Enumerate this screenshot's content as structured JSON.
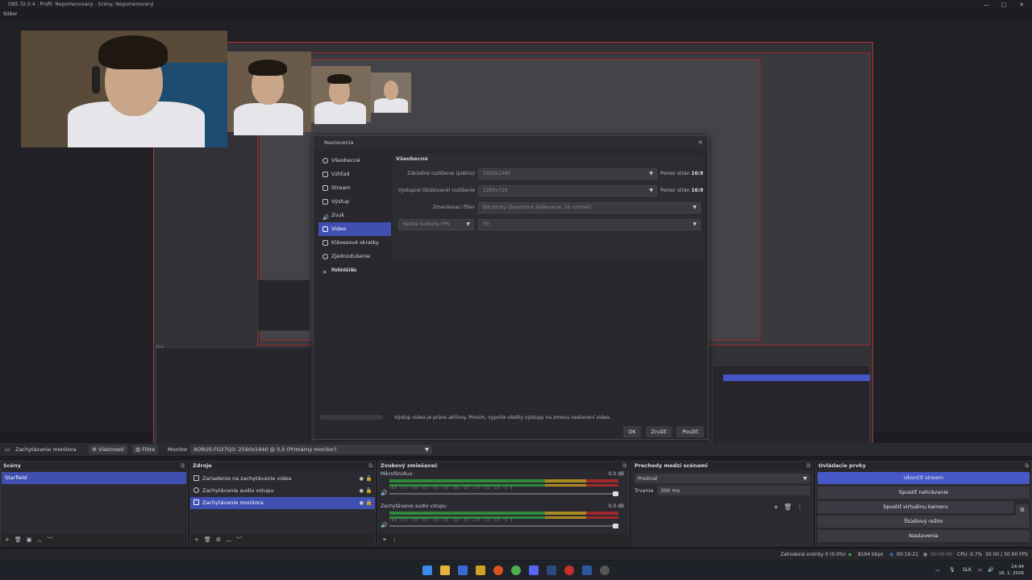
{
  "window": {
    "title": "OBS 32.0.4 - Profil: Nepomenovaný - Scény: Nepomenovaný",
    "menu_first": "Súbor"
  },
  "preview": {
    "nested_zoom": "92%",
    "nested_fit": "Vnesnot do okna"
  },
  "settings_dialog": {
    "title": "Nastavenia",
    "nav": [
      {
        "label": "Všeobecné",
        "icon": "gear-icon"
      },
      {
        "label": "Vzhľad",
        "icon": "appearance-icon"
      },
      {
        "label": "Stream",
        "icon": "stream-icon"
      },
      {
        "label": "Výstup",
        "icon": "output-icon"
      },
      {
        "label": "Zvuk",
        "icon": "speaker-icon"
      },
      {
        "label": "Video",
        "icon": "monitor-icon",
        "selected": true
      },
      {
        "label": "Klávesové skratky",
        "icon": "keyboard-icon"
      },
      {
        "label": "Zjednodušenie ovládania",
        "icon": "accessibility-icon"
      },
      {
        "label": "Pokročilé",
        "icon": "wrench-icon"
      }
    ],
    "section_title": "Všeobecné",
    "base_resolution_label": "Základné rozlíšenie (plátno)",
    "base_resolution_value": "1920x1080",
    "base_aspect_label": "Pomer strán",
    "base_aspect_value": "16:9",
    "output_resolution_label": "Výstupné (škálované) rozlíšenie",
    "output_resolution_value": "1280x720",
    "output_aspect_label": "Pomer strán",
    "output_aspect_value": "16:9",
    "downscale_filter_label": "Zmenšovací filter",
    "downscale_filter_value": "Bikubický (Zaostrené škálovanie, 16 vzoriek)",
    "fps_type_value": "Bežné hodnoty FPS",
    "fps_value": "30",
    "warning": "Výstup videa je práve aktívny. Prosím, vypnite všetky výstupy na zmenu nastavení videa.",
    "btn_ok": "OK",
    "btn_cancel": "Zrušiť",
    "btn_apply": "Použiť"
  },
  "source_toolbar": {
    "selected_source": "Zachytávanie monitora",
    "properties": "Vlastnosti",
    "filters": "Filtre",
    "monitor_label": "Monitor",
    "monitor_value": "AORUS FO27Q3: 2560x1440 @ 0,0 (Primárny monitor)"
  },
  "scenes": {
    "title": "Scény",
    "items": [
      "Starfield"
    ]
  },
  "sources": {
    "title": "Zdroje",
    "items": [
      {
        "label": "Zariadenie na zachytávanie videa",
        "icon": "camera-icon"
      },
      {
        "label": "Zachytávanie audio vstupu",
        "icon": "microphone-icon"
      },
      {
        "label": "Zachytávanie monitora",
        "icon": "monitor-icon",
        "selected": true
      }
    ]
  },
  "mixer": {
    "title": "Zvukový zmiešavač",
    "channels": [
      {
        "name": "Mikrofón/Aux",
        "db": "0.0 dB"
      },
      {
        "name": "Zachytávanie audio vstupu",
        "db": "0.0 dB"
      }
    ],
    "ticks": "-60 -55 -50 -45 -40 -35 -30 -25 -20 -15 -10 -5 0"
  },
  "transitions": {
    "title": "Prechody medzi scénami",
    "type": "Prelínať",
    "duration_label": "Trvanie",
    "duration_value": "300 ms"
  },
  "controls": {
    "title": "Ovládacie prvky",
    "buttons": [
      "Ukončiť stream",
      "Spustiť nahrávanie",
      "Spustiť virtuálnu kameru",
      "Štúdiový režim",
      "Nastavenia"
    ]
  },
  "status": {
    "dropped": "Zahodené snímky 0 (0.0%)",
    "bitrate": "8194 kbps",
    "stream_time": "00:19:21",
    "rec_time": "00:00:00",
    "cpu": "CPU: 0.7%",
    "fps": "30.00 / 30.00 FPS"
  },
  "taskbar": {
    "lang": "SLK",
    "time": "14:44",
    "date": "18. 1. 2026"
  },
  "colors": {
    "accent": "#4658c8",
    "selection": "#4050b0",
    "canvas_border": "#b83030"
  }
}
